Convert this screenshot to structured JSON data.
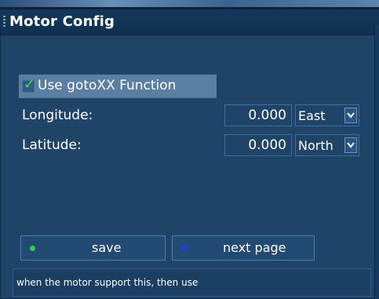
{
  "window": {
    "title": "Motor Config"
  },
  "options": {
    "use_gotoxx": {
      "label": "Use gotoXX Function",
      "checked": true
    }
  },
  "fields": {
    "longitude": {
      "label": "Longitude:",
      "value": "0.000",
      "direction": "East"
    },
    "latitude": {
      "label": "Latitude:",
      "value": "0.000",
      "direction": "North"
    }
  },
  "buttons": {
    "save": {
      "label": "save",
      "color": "#2bd24a"
    },
    "next_page": {
      "label": "next page",
      "color": "#1f3cff"
    }
  },
  "footer": {
    "help_text": "when the motor support this, then use"
  },
  "icons": {
    "check": "checkmark-icon",
    "dropdown": "chevron-down-icon",
    "save_dot": "green-dot-icon",
    "next_dot": "blue-dot-icon"
  }
}
